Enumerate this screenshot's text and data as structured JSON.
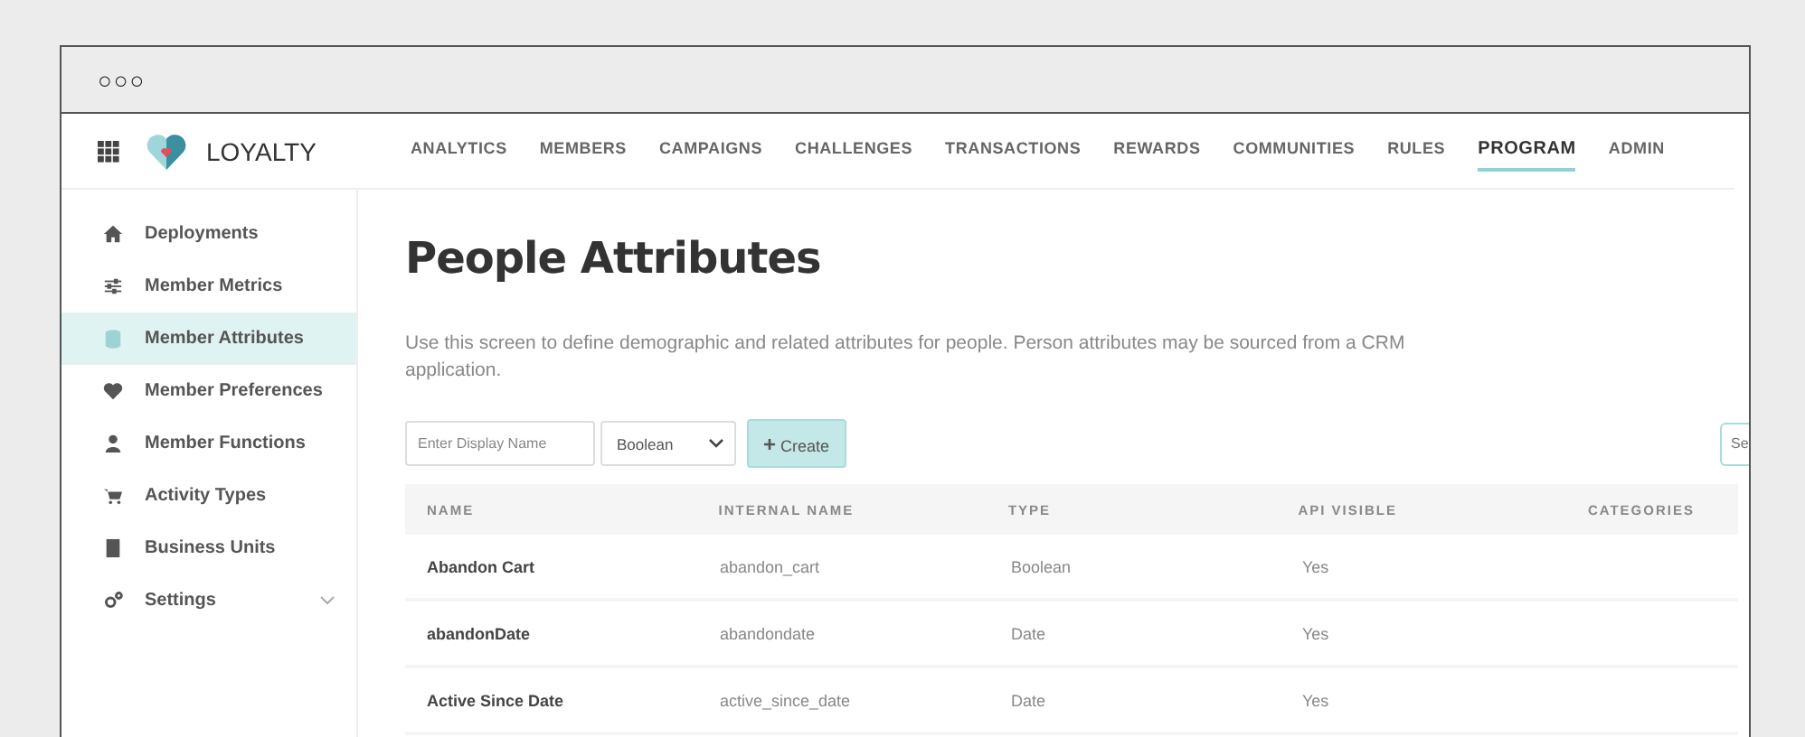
{
  "window": {
    "controls": "○○○"
  },
  "brand": "LOYALTY",
  "nav": [
    {
      "label": "ANALYTICS",
      "selected": false
    },
    {
      "label": "MEMBERS",
      "selected": false
    },
    {
      "label": "CAMPAIGNS",
      "selected": false
    },
    {
      "label": "CHALLENGES",
      "selected": false
    },
    {
      "label": "TRANSACTIONS",
      "selected": false
    },
    {
      "label": "REWARDS",
      "selected": false
    },
    {
      "label": "COMMUNITIES",
      "selected": false
    },
    {
      "label": "RULES",
      "selected": false
    },
    {
      "label": "PROGRAM",
      "selected": true
    },
    {
      "label": "ADMIN",
      "selected": false
    }
  ],
  "sidebar": {
    "items": [
      {
        "label": "Deployments",
        "kind": "home",
        "selected": false
      },
      {
        "label": "Member Metrics",
        "kind": "sliders",
        "selected": false
      },
      {
        "label": "Member Attributes",
        "kind": "database",
        "selected": true
      },
      {
        "label": "Member Preferences",
        "kind": "heart",
        "selected": false
      },
      {
        "label": "Member Functions",
        "kind": "user",
        "selected": false
      },
      {
        "label": "Activity Types",
        "kind": "cart",
        "selected": false
      },
      {
        "label": "Business Units",
        "kind": "building",
        "selected": false
      },
      {
        "label": "Settings",
        "kind": "gears",
        "selected": false,
        "expandable": true
      }
    ]
  },
  "page": {
    "title": "People Attributes",
    "description": "Use this screen to define demographic and related attributes for people. Person attributes may be sourced from a CRM application."
  },
  "form": {
    "name_placeholder": "Enter Display Name",
    "type_value": "Boolean",
    "create_icon": "+",
    "create_label": "Create",
    "search_placeholder": "Se"
  },
  "table": {
    "columns": [
      "NAME",
      "INTERNAL NAME",
      "TYPE",
      "API VISIBLE",
      "CATEGORIES"
    ],
    "rows": [
      [
        "Abandon Cart",
        "abandon_cart",
        "Boolean",
        "Yes"
      ],
      [
        "abandonDate",
        "abandondate",
        "Date",
        "Yes"
      ],
      [
        "Active Since Date",
        "active_since_date",
        "Date",
        "Yes"
      ]
    ]
  }
}
